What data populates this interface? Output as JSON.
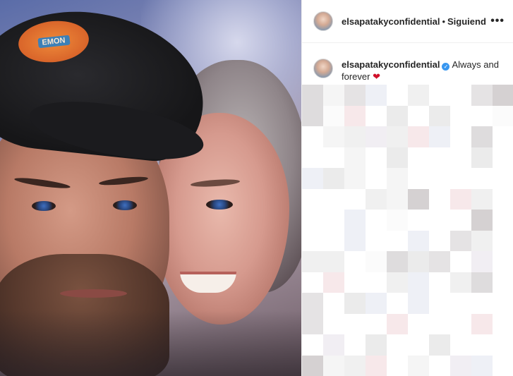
{
  "post": {
    "username": "elsapatakyconfidential",
    "separator": "•",
    "follow_state": "Siguiendo",
    "more_icon": "more-horizontal-icon"
  },
  "caption": {
    "username": "elsapatakyconfidential",
    "verified_icon": "verified-badge-icon",
    "text": "Always and forever",
    "heart": "❤"
  },
  "photo": {
    "cap_badge_text": "EMON"
  },
  "colors": {
    "verified": "#3897f0",
    "heart": "#d0112b",
    "border": "#efefef"
  }
}
